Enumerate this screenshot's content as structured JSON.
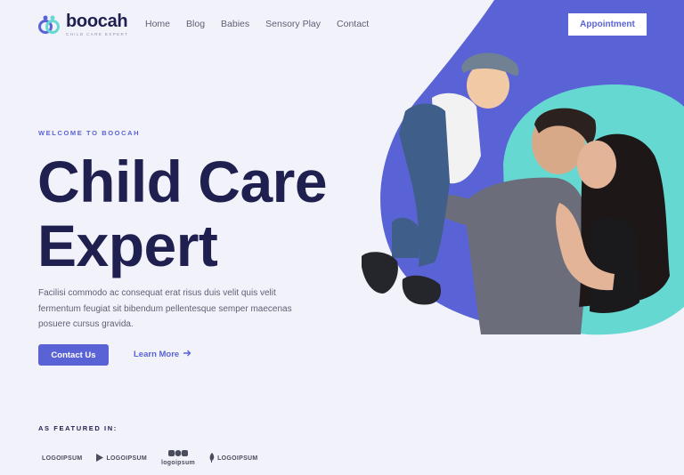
{
  "brand": {
    "name": "boocah",
    "tagline": "CHILD CARE EXPERT",
    "colors": {
      "primary": "#5a63d6",
      "accent": "#66d8d2",
      "dark": "#1f2050"
    }
  },
  "nav": {
    "items": [
      "Home",
      "Blog",
      "Babies",
      "Sensory Play",
      "Contact"
    ]
  },
  "header": {
    "appointment_label": "Appointment"
  },
  "hero": {
    "eyebrow": "WELCOME TO BOOCAH",
    "title_line1": "Child Care",
    "title_line2": "Expert",
    "paragraph": "Facilisi commodo ac consequat erat risus duis velit quis velit fermentum feugiat sit bibendum pellentesque semper maecenas posuere cursus gravida.",
    "contact_label": "Contact Us",
    "learn_more_label": "Learn More"
  },
  "featured": {
    "heading": "AS FEATURED IN:",
    "logos": [
      "LOGOIPSUM",
      "LOGOIPSUM",
      "logoipsum",
      "LOGOIPSUM"
    ]
  },
  "icons": {
    "logo": "double-ring-logo-icon",
    "arrow": "arrow-right-icon"
  }
}
